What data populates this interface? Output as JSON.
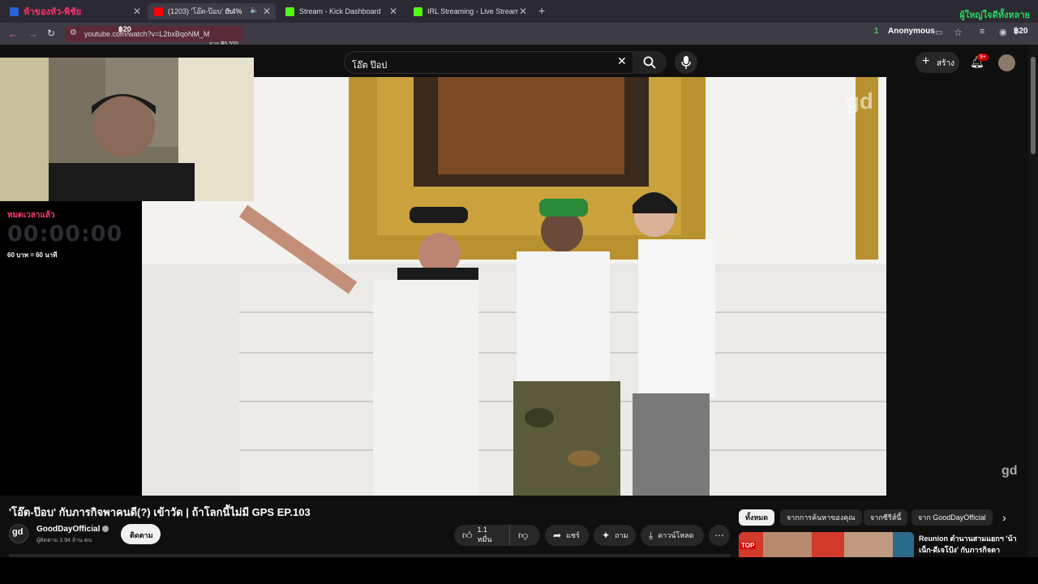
{
  "tabs": [
    {
      "label": "ห้าของหัว-พิชัย",
      "active": false,
      "favicon_color": "#2a62d9"
    },
    {
      "label": "(1203) 'โอ๊ต-ป๊อบ' กับภารกิจ",
      "active": true,
      "favicon_color": "#ff0000",
      "badge": "0.4%"
    },
    {
      "label": "Stream - Kick Dashboard",
      "active": false,
      "favicon_color": "#53fc18"
    },
    {
      "label": "IRL Streaming - Live Streams o",
      "active": false,
      "favicon_color": "#53fc18"
    }
  ],
  "new_tab": "+",
  "top_right_overlay": "ผู้ใหญ่ใจดีทั้งหลาย",
  "address": {
    "url": "youtube.com/watch?v=L2bxBqoNM_M",
    "donation_amount": "฿20",
    "donation_from": "จาก ฿5,555",
    "viewer_count": "1",
    "viewer_name": "Anonymous",
    "right_amount": "฿20"
  },
  "yt": {
    "search_query": "โอ๊ต ป๊อป",
    "create_label": "สร้าง",
    "notif_count": "9+"
  },
  "timer": {
    "title": "หมดเวลาแล้ว",
    "time": "00:00:00",
    "rate": "60 บาท = 60 นาที"
  },
  "video": {
    "title": "'โอ๊ต-ป๊อบ' กับภารกิจพาคนดี(?) เข้าวัด | ถ้าโลกนี้ไม่มี GPS EP.103",
    "channel": "GoodDayOfficial",
    "subscribers": "ผู้ติดตาม 3.94 ล้าน คน",
    "subscribe_label": "ติดตาม",
    "likes": "1.1 หมื่น",
    "share_label": "แชร์",
    "ask_label": "ถาม",
    "download_label": "ดาวน์โหลด",
    "watermark": "gd"
  },
  "chips": [
    "ทั้งหมด",
    "จากการค้นหาของคุณ",
    "จากซีรีส์นี้",
    "จาก GoodDayOfficial"
  ],
  "recommended": {
    "title": "Reunion ตำนานสามแยกฯ 'น้า",
    "title_line2": "เน็ก-ดีเจโป้ง' กับภารกิจตา",
    "thumb_label": "TOP"
  }
}
